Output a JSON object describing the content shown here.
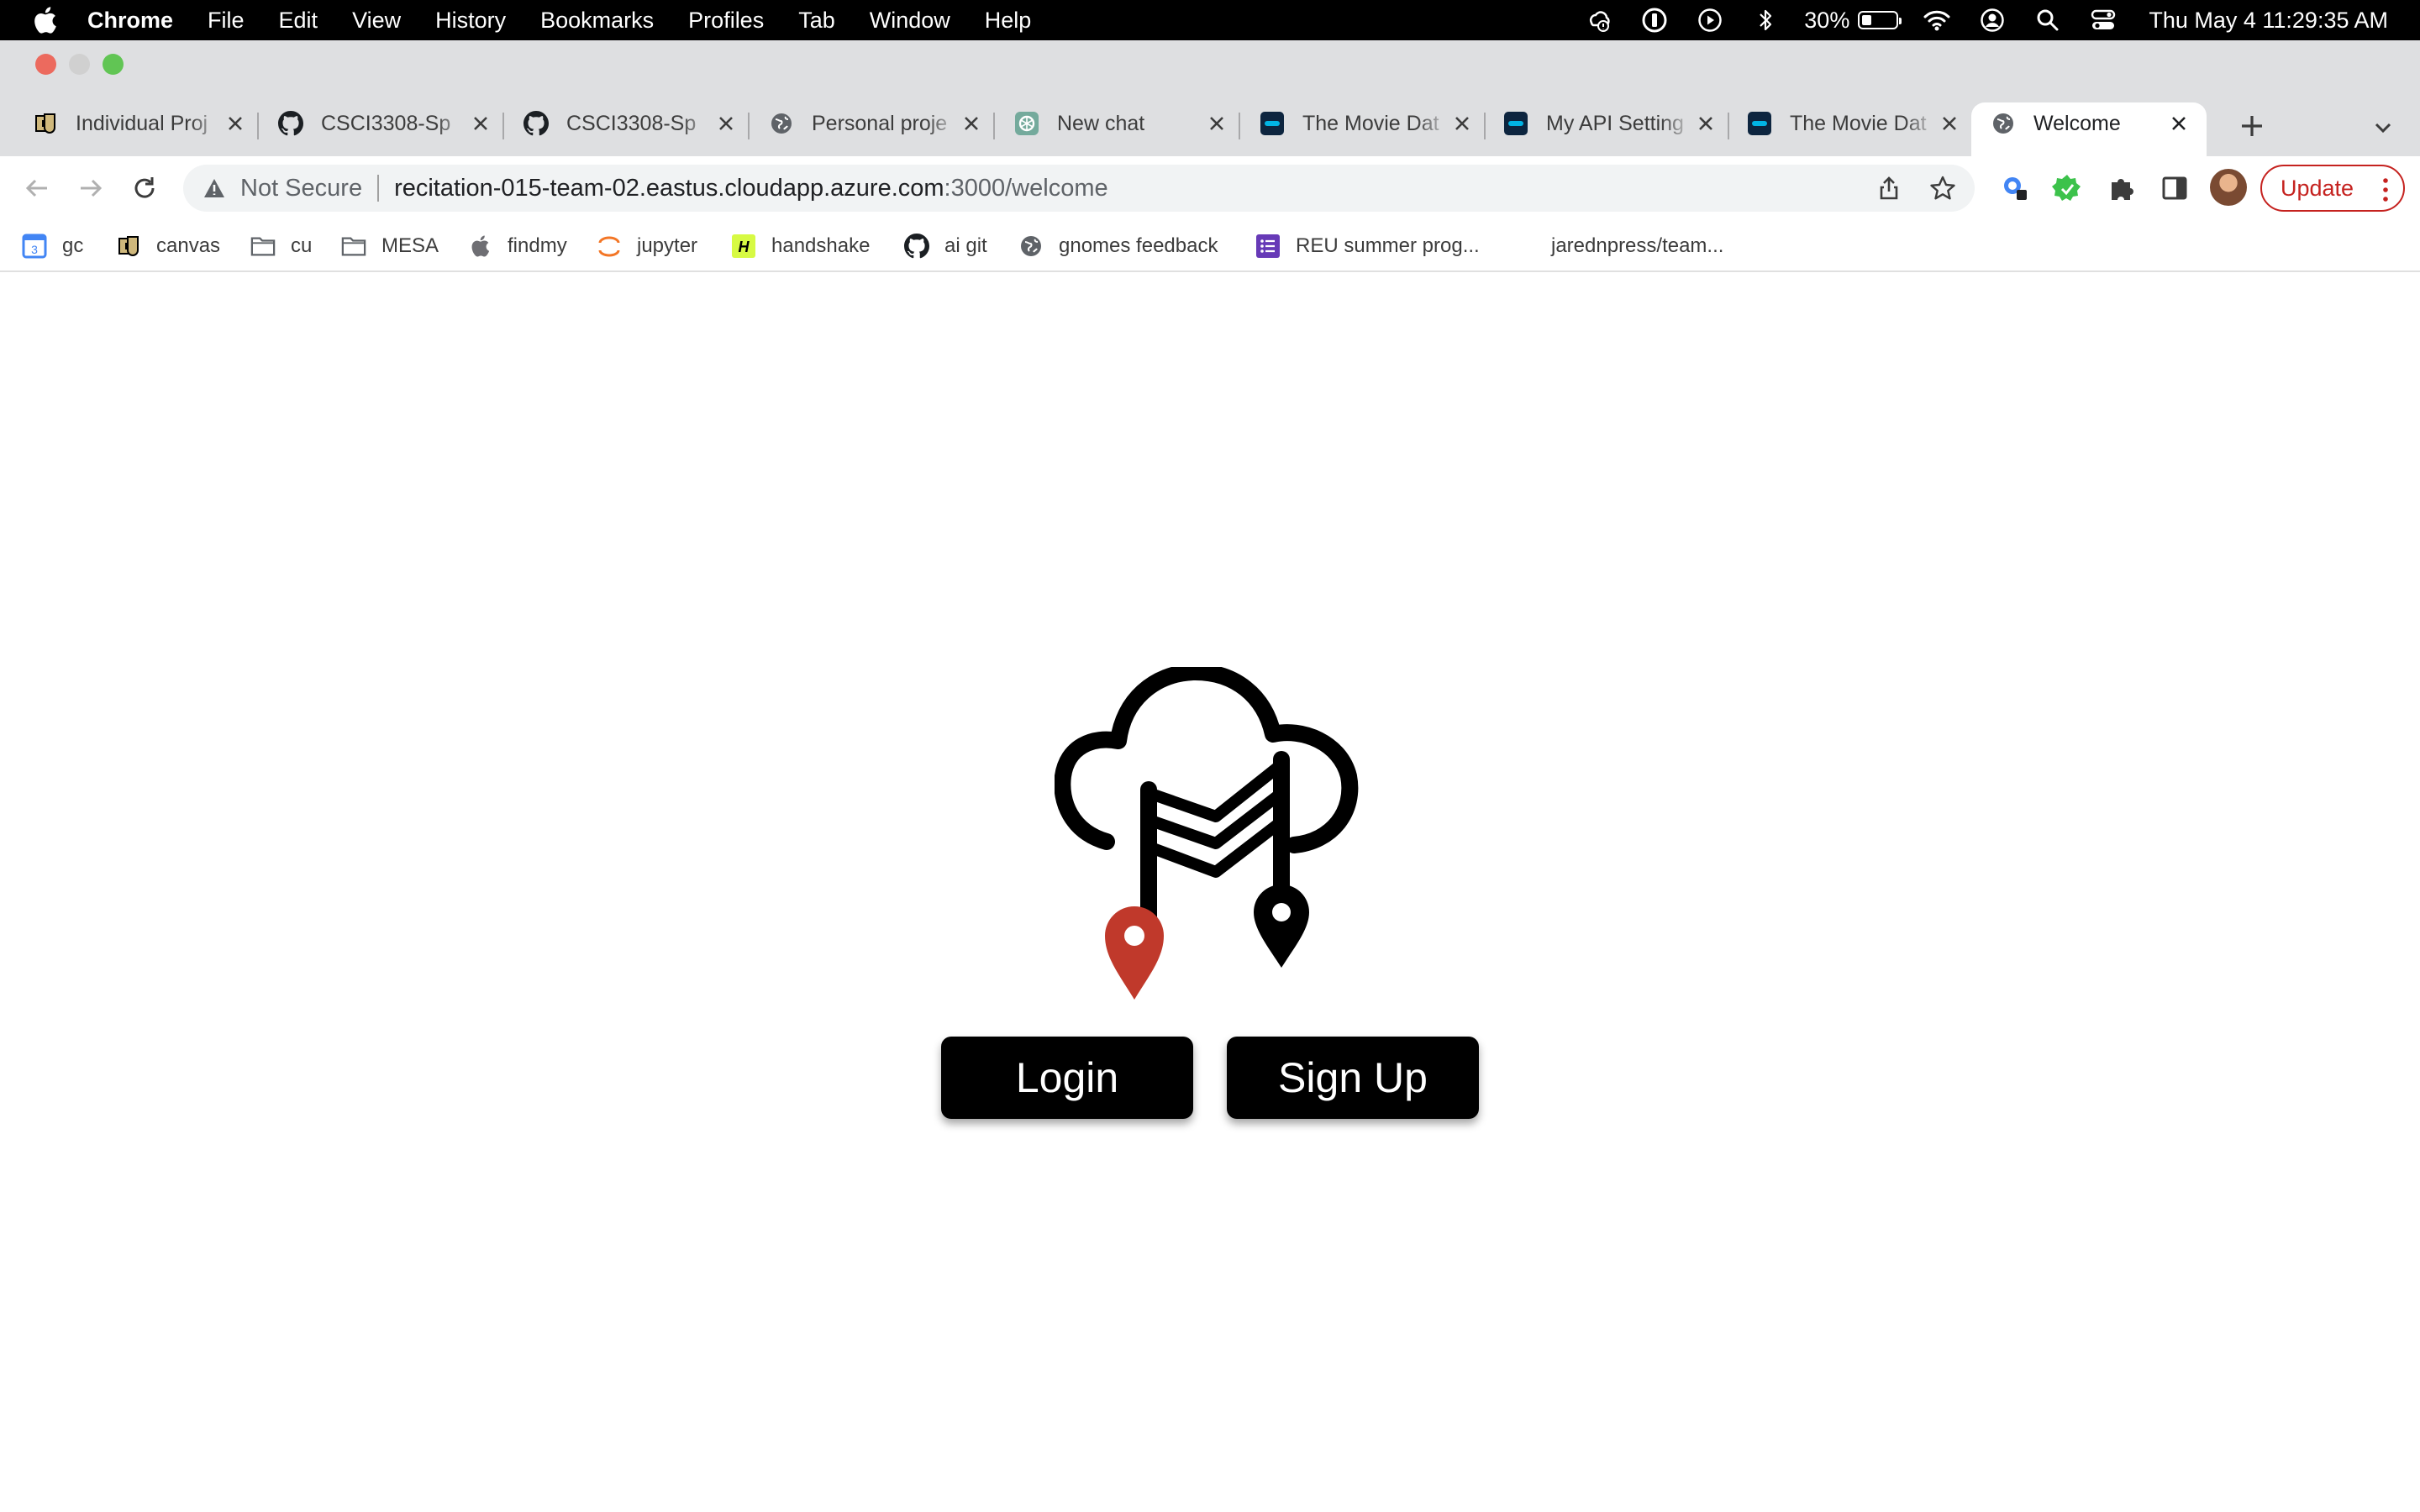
{
  "menubar": {
    "app_name": "Chrome",
    "items": [
      "File",
      "Edit",
      "View",
      "History",
      "Bookmarks",
      "Profiles",
      "Tab",
      "Window",
      "Help"
    ],
    "battery_percent": "30%",
    "battery_level": 0.3,
    "clock": "Thu May 4  11:29:35 AM",
    "status_icons": [
      "weather-icon",
      "1password-icon",
      "play-icon",
      "bluetooth-icon",
      "battery-icon",
      "wifi-icon",
      "user-icon",
      "spotlight-icon",
      "control-center-icon"
    ]
  },
  "tabs": [
    {
      "title": "Individual Proj",
      "icon": "cu-icon"
    },
    {
      "title": "CSCI3308-Sp",
      "icon": "github-icon"
    },
    {
      "title": "CSCI3308-Sp",
      "icon": "github-icon"
    },
    {
      "title": "Personal proje",
      "icon": "globe-icon"
    },
    {
      "title": "New chat",
      "icon": "chatgpt-icon"
    },
    {
      "title": "The Movie Dat",
      "icon": "tmdb-icon"
    },
    {
      "title": "My API Setting",
      "icon": "tmdb-icon"
    },
    {
      "title": "The Movie Dat",
      "icon": "tmdb-icon"
    },
    {
      "title": "Welcome",
      "icon": "globe-icon",
      "active": true
    }
  ],
  "omnibox": {
    "security_label": "Not Secure",
    "host": "recitation-015-team-02.eastus.cloudapp.azure.com",
    "path": ":3000/welcome"
  },
  "toolbar": {
    "update_label": "Update"
  },
  "bookmarks": [
    {
      "label": "gc",
      "icon": "calendar-icon"
    },
    {
      "label": "canvas",
      "icon": "cu-icon"
    },
    {
      "label": "cu",
      "icon": "folder-icon"
    },
    {
      "label": "MESA",
      "icon": "folder-icon"
    },
    {
      "label": "findmy",
      "icon": "apple-icon"
    },
    {
      "label": "jupyter",
      "icon": "jupyter-icon"
    },
    {
      "label": "handshake",
      "icon": "handshake-icon"
    },
    {
      "label": "ai git",
      "icon": "github-icon"
    },
    {
      "label": "gnomes feedback",
      "icon": "globe-icon"
    },
    {
      "label": "REU summer prog...",
      "icon": "form-icon"
    },
    {
      "label": "jarednpress/team...",
      "icon": "blank-icon"
    }
  ],
  "page": {
    "login_label": "Login",
    "signup_label": "Sign Up"
  },
  "colors": {
    "pin_red": "#c0392b",
    "update_red": "#c5221f",
    "button_bg": "#000000"
  }
}
